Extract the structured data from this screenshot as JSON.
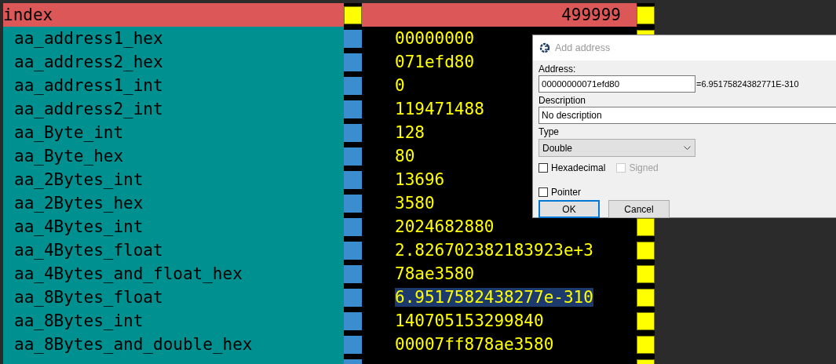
{
  "table": {
    "header": {
      "name": "index",
      "value": "499999"
    },
    "rows": [
      {
        "name": "aa_address1_hex",
        "value": "00000000",
        "selected": false
      },
      {
        "name": "aa_address2_hex",
        "value": "071efd80",
        "selected": false,
        "marker_hidden": true
      },
      {
        "name": "aa_address1_int",
        "value": "0",
        "selected": false,
        "marker_hidden": true
      },
      {
        "name": "aa_address2_int",
        "value": "119471488",
        "selected": false,
        "marker_hidden": true
      },
      {
        "name": "aa_Byte_int",
        "value": "128",
        "selected": false,
        "marker_hidden": true
      },
      {
        "name": "aa_Byte_hex",
        "value": "80",
        "selected": false
      },
      {
        "name": "aa_2Bytes_int",
        "value": "13696",
        "selected": false
      },
      {
        "name": "aa_2Bytes_hex",
        "value": "3580",
        "selected": false
      },
      {
        "name": "aa_4Bytes_int",
        "value": "2024682880",
        "selected": false
      },
      {
        "name": "aa_4Bytes_float",
        "value": "2.826702382183923e+3",
        "selected": false
      },
      {
        "name": "aa_4Bytes_and_float_hex",
        "value": "78ae3580",
        "selected": false
      },
      {
        "name": "aa_8Bytes_float",
        "value": "6.9517582438277e-310",
        "selected": true
      },
      {
        "name": "aa_8Bytes_int",
        "value": "140705153299840",
        "selected": false
      },
      {
        "name": "aa_8Bytes_and_double_hex",
        "value": "00007ff878ae3580",
        "selected": false
      }
    ]
  },
  "dialog": {
    "title": "Add address",
    "address": {
      "label": "Address:",
      "value": "00000000071efd80",
      "result": "=6.95175824382771E-310"
    },
    "description": {
      "label": "Description",
      "value": "No description"
    },
    "type": {
      "label": "Type",
      "value": "Double"
    },
    "options": [
      {
        "label": "Hexadecimal",
        "checked": false,
        "disabled": false
      },
      {
        "label": "Signed",
        "checked": false,
        "disabled": true
      }
    ],
    "pointer": {
      "label": "Pointer",
      "checked": false,
      "disabled": false
    },
    "buttons": [
      {
        "label": "OK",
        "focused": true
      },
      {
        "label": "Cancel",
        "focused": false
      }
    ]
  }
}
